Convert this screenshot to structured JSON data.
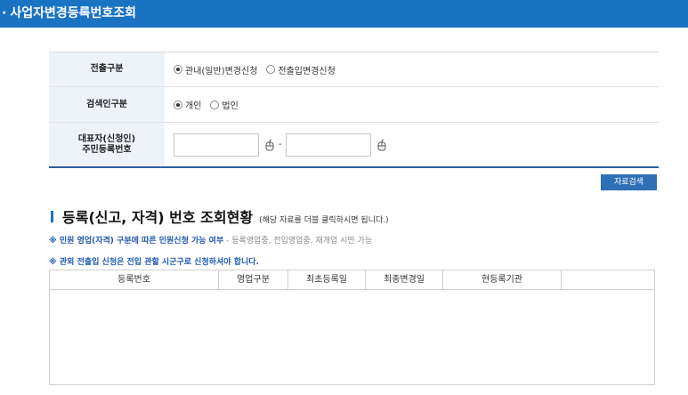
{
  "header": {
    "bullet": "·",
    "title": "사업자변경등록번호조회"
  },
  "form": {
    "row1": {
      "label": "전출구분",
      "options": [
        "관내(일반)변경신청",
        "전출입변경신청"
      ],
      "selected": 0
    },
    "row2": {
      "label": "검색인구분",
      "options": [
        "개인",
        "법인"
      ],
      "selected": 0
    },
    "row3": {
      "label_line1": "대표자(신청인)",
      "label_line2": "주민등록번호",
      "ssn_front": "",
      "ssn_back": "",
      "separator": "-"
    }
  },
  "search_button": "자료검색",
  "section": {
    "title": "등록(신고, 자격) 번호 조회현황",
    "subtitle": "(해당 자료를 더블 클릭하시면 됩니다.)",
    "note1_bold": "※ 민원 영업(자격) 구분에 따른 민원신청 가능 여부",
    "note1_rest": " - 등록영업중, 전입영업중, 재개업 시만 가능",
    "note2": "※ 관외 전출입 신청은 전입 관할 시군구로 신청하셔야 합니다."
  },
  "table": {
    "columns": [
      "등록번호",
      "영업구분",
      "최초등록일",
      "최종변경일",
      "현등록기관",
      ""
    ],
    "rows": []
  }
}
